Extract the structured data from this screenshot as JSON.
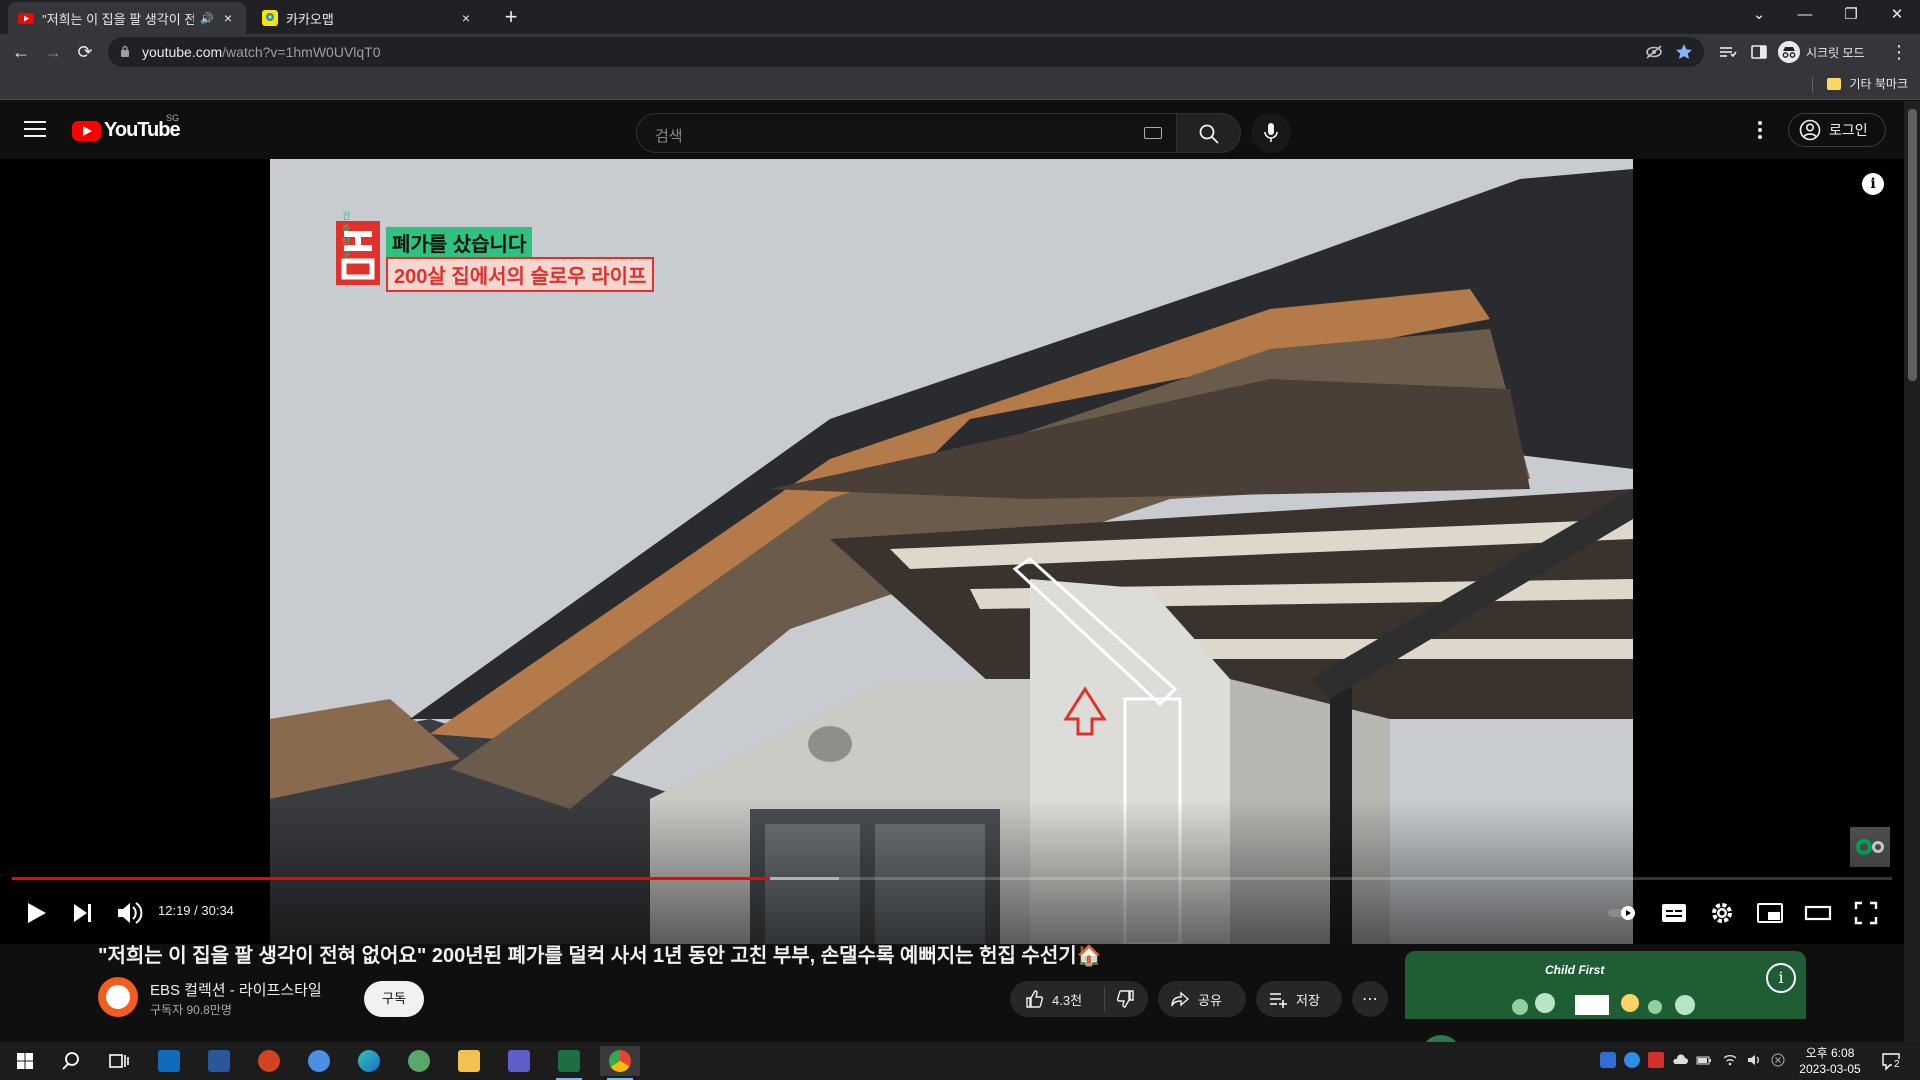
{
  "browser": {
    "tabs": [
      {
        "title": "\"저희는 이 집을 팔 생각이 전혀 없어요\"",
        "speaker": "🔊",
        "close": "×"
      },
      {
        "title": "카카오맵",
        "close": "×"
      }
    ],
    "new_tab": "+",
    "window_controls": {
      "tab_search": "⌄",
      "minimize": "—",
      "restore": "❐",
      "close": "✕"
    },
    "nav": {
      "back": "←",
      "forward": "→",
      "reload": "⟳"
    },
    "url_host": "youtube.com",
    "url_path": "/watch?v=1hmW0UVlqT0",
    "incognito_label": "시크릿 모드",
    "menu": "⋮",
    "other_bookmarks": "기타 북마크"
  },
  "youtube": {
    "logo_text": "YouTube",
    "country_code": "SG",
    "search_placeholder": "검색",
    "sign_in": "로그인",
    "video": {
      "overlay_tag": "건축탐구",
      "overlay_line1": "폐가를 샀습니다",
      "overlay_line2": "200살 집에서의 슬로우 라이프",
      "current_time": "12:19",
      "duration": "30:34",
      "time_display": "12:19 / 30:34",
      "progress_played": 0.403,
      "progress_buffered": 0.44
    },
    "title": "\"저희는 이 집을 팔 생각이 전혀 없어요\" 200년된 폐가를 덜컥 사서 1년 동안 고친 부부, 손댈수록 예뻐지는 헌집 수선기🏠",
    "channel": {
      "name": "EBS 컬렉션 - 라이프스타일",
      "subscribers": "구독자 90.8만명"
    },
    "subscribe": "구독",
    "likes": "4.3천",
    "share": "공유",
    "save": "저장",
    "more": "⋯",
    "ad": {
      "brand": "Child First"
    }
  },
  "taskbar": {
    "clock_time": "오후 6:08",
    "clock_date": "2023-03-05",
    "notification_count": "2"
  },
  "colors": {
    "yt_red": "#ff0000",
    "bg": "#0f0f0f",
    "chrome_bg": "#202124",
    "chrome_toolbar": "#35363a",
    "excel_green": "#1d6f42"
  }
}
